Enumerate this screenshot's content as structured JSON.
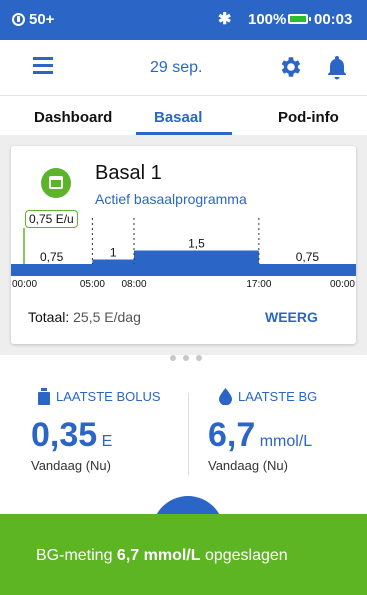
{
  "status": {
    "pod_level": "50+",
    "battery": "100%",
    "time": "00:03"
  },
  "header": {
    "date": "29 sep."
  },
  "tabs": [
    {
      "label": "Dashboard"
    },
    {
      "label": "Basaal"
    },
    {
      "label": "Pod-info"
    }
  ],
  "basal_card": {
    "title": "Basal 1",
    "subtitle": "Actief basaalprogramma",
    "current_rate": "0,75 E/u",
    "total_label": "Totaal:",
    "total_value": "25,5 E/dag",
    "view_button": "WEERG"
  },
  "chart_data": {
    "type": "bar",
    "segments": [
      {
        "start": 0,
        "end": 5,
        "value": 0.75,
        "label": "0,75"
      },
      {
        "start": 5,
        "end": 8,
        "value": 1,
        "label": "1"
      },
      {
        "start": 8,
        "end": 17,
        "value": 1.5,
        "label": "1,5"
      },
      {
        "start": 17,
        "end": 24,
        "value": 0.75,
        "label": "0,75"
      }
    ],
    "tick_labels": [
      "00:00",
      "05:00",
      "08:00",
      "17:00",
      "00:00"
    ],
    "tick_hours": [
      0,
      5,
      8,
      17,
      24
    ],
    "color": "#2B66C6"
  },
  "bolus_panel": {
    "header": "LAATSTE BOLUS",
    "value": "0,35",
    "unit": "E",
    "when": "Vandaag (Nu)"
  },
  "bg_panel": {
    "header": "LAATSTE BG",
    "value": "6,7",
    "unit": "mmol/L",
    "when": "Vandaag (Nu)"
  },
  "snackbar": {
    "prefix": "BG-meting",
    "value": "6,7 mmol/L",
    "suffix": "opgeslagen"
  },
  "colors": {
    "primary": "#2B66C6",
    "accent_green": "#5CB32C",
    "snackbar": "#5DB523"
  }
}
